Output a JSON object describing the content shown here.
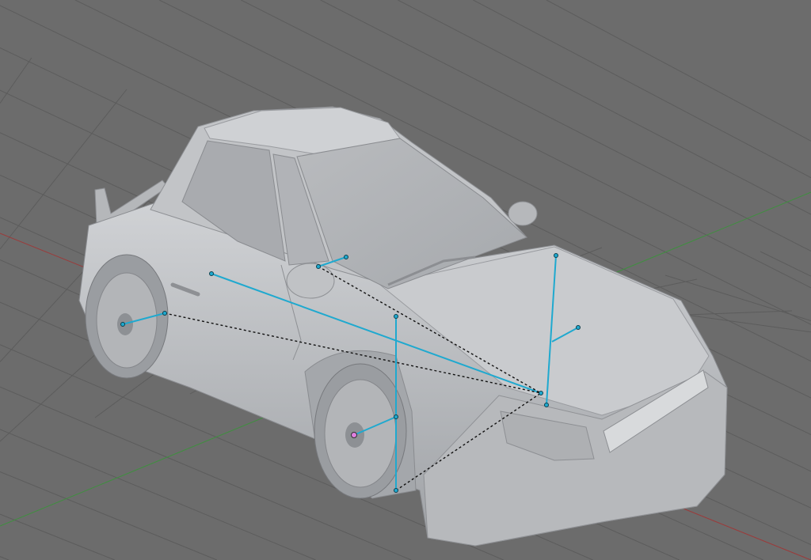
{
  "viewport": {
    "background": "#6c6c6c",
    "grid_color": "#5c5c5c",
    "x_axis_color": "#9c3a3a",
    "y_axis_color": "#3f8f3f",
    "model_color": "#c4c6c9",
    "bone_color": "#1fa9cf",
    "selected_joint_color": "#e080e0"
  }
}
